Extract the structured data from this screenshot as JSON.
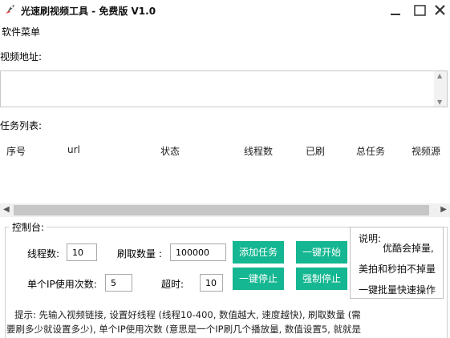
{
  "window": {
    "title": "光速刷视频工具 - 免费版 V1.0"
  },
  "menu": {
    "software_menu": "软件菜单"
  },
  "video_address": {
    "label": "视频地址:"
  },
  "task_list": {
    "label": "任务列表:",
    "columns": [
      "序号",
      "url",
      "状态",
      "线程数",
      "已刷",
      "总任务",
      "视频源"
    ]
  },
  "console": {
    "legend": "控制台:",
    "threads_label": "线程数:",
    "threads_value": "10",
    "brush_count_label": "刷取数量 :",
    "brush_count_value": "100000",
    "ip_uses_label": "单个IP使用次数:",
    "ip_uses_value": "5",
    "timeout_label": "超时:",
    "timeout_value": "10",
    "add_task_button": "添加任务",
    "start_all_button": "一键开始",
    "stop_all_button": "一键停止",
    "force_stop_button": "强制停止",
    "accent_color": "#14b791"
  },
  "notes": {
    "title": "说明:",
    "line1": "优酷会掉量,",
    "line2": "美拍和秒拍不掉量",
    "line3": "一键批量快速操作"
  },
  "tip": {
    "line1": "提示: 先输入视频链接, 设置好线程 (线程10-400, 数值越大, 速度越快), 刷取数量 (需",
    "line2": "要刷多少就设置多少), 单个IP使用次数 (意思是一个IP刷几个播放量, 数值设置5, 就就是"
  }
}
